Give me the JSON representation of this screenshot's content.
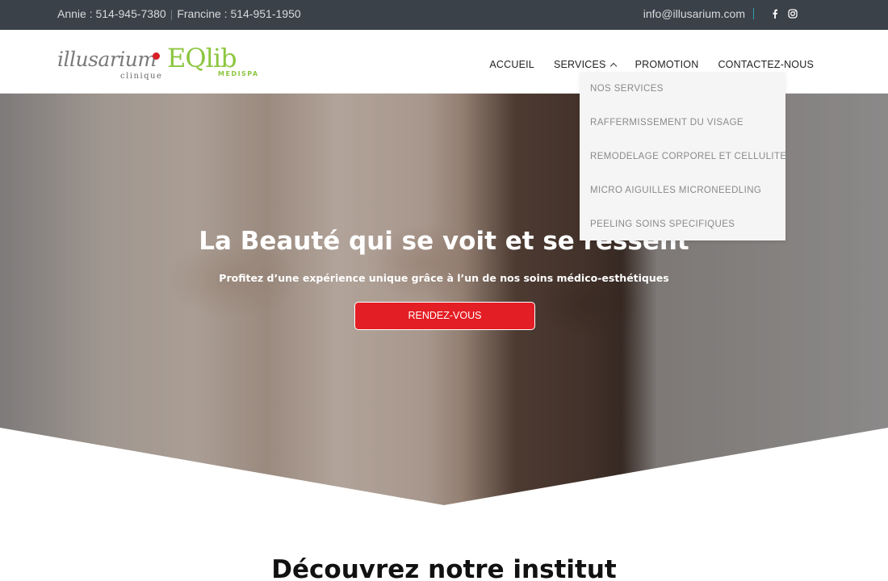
{
  "topbar": {
    "phone1": "Annie : 514-945-7380",
    "phone2": "Francine : 514-951-1950",
    "separator": "|",
    "email": "info@illusarium.com",
    "social": [
      "facebook-icon",
      "instagram-icon"
    ]
  },
  "logo": {
    "illusarium": "illusarium",
    "clinique": "clinique",
    "eqlib": "EQlib",
    "medispa": "MEDISPA"
  },
  "nav": {
    "accueil": "ACCUEIL",
    "services": "SERVICES",
    "promotion": "PROMOTION",
    "contact": "CONTACTEZ-NOUS"
  },
  "dropdown": {
    "items": [
      "NOS SERVICES",
      "RAFFERMISSEMENT DU VISAGE",
      "REMODELAGE CORPOREL ET CELLULITE",
      "MICRO AIGUILLES MICRONEEDLING",
      "PEELING SOINS SPECIFIQUES"
    ]
  },
  "hero": {
    "title": "La Beauté qui se voit et se ressent",
    "subtitle": "Profitez d’une expérience unique grâce à l’un de nos soins médico-esthétiques",
    "button": "RENDEZ-VOUS"
  },
  "section": {
    "title": "Découvrez notre institut"
  },
  "colors": {
    "topbar_bg": "#3b4148",
    "accent_red": "#e31e24",
    "logo_green": "#8cc63f",
    "divider_teal": "#2e9fb1"
  }
}
